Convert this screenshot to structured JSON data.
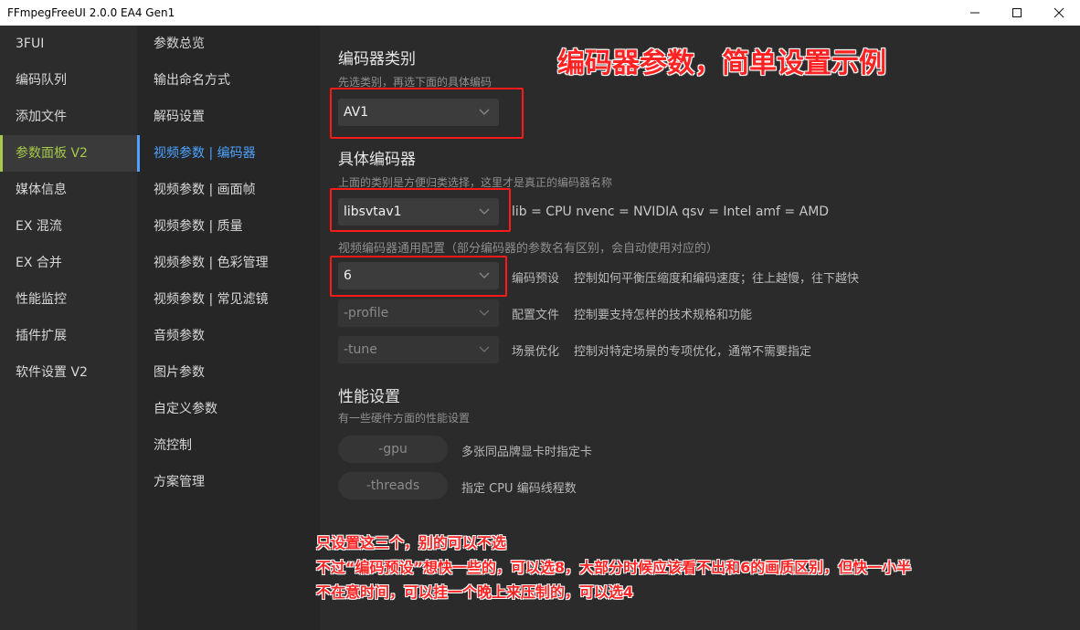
{
  "window": {
    "title": "FFmpegFreeUI 2.0.0 EA4 Gen1",
    "minimize": "—",
    "maximize": "☐",
    "close": "✕"
  },
  "sidebar_primary": {
    "items": [
      {
        "label": "3FUI"
      },
      {
        "label": "编码队列"
      },
      {
        "label": "添加文件"
      },
      {
        "label": "参数面板 V2",
        "active": true
      },
      {
        "label": "媒体信息"
      },
      {
        "label": "EX 混流"
      },
      {
        "label": "EX 合并"
      },
      {
        "label": "性能监控"
      },
      {
        "label": "插件扩展"
      },
      {
        "label": "软件设置 V2"
      }
    ]
  },
  "sidebar_secondary": {
    "items": [
      {
        "label": "参数总览"
      },
      {
        "label": "输出命名方式"
      },
      {
        "label": "解码设置"
      },
      {
        "label": "视频参数 | 编码器",
        "active": true
      },
      {
        "label": "视频参数 | 画面帧"
      },
      {
        "label": "视频参数 | 质量"
      },
      {
        "label": "视频参数 | 色彩管理"
      },
      {
        "label": "视频参数 | 常见滤镜"
      },
      {
        "label": "音频参数"
      },
      {
        "label": "图片参数"
      },
      {
        "label": "自定义参数"
      },
      {
        "label": "流控制"
      },
      {
        "label": "方案管理"
      }
    ]
  },
  "main": {
    "encoder_category": {
      "title": "编码器类别",
      "desc": "先选类别，再选下面的具体编码",
      "value": "AV1"
    },
    "specific_encoder": {
      "title": "具体编码器",
      "desc": "上面的类别是方便归类选择，这里才是真正的编码器名称",
      "value": "libsvtav1",
      "hint": "lib = CPU   nvenc = NVIDIA   qsv = Intel   amf = AMD"
    },
    "common_config_desc": "视频编码器通用配置（部分编码器的参数名有区别，会自动使用对应的）",
    "preset": {
      "value": "6",
      "label": "编码预设",
      "desc": "控制如何平衡压缩度和编码速度；往上越慢，往下越快"
    },
    "profile": {
      "value": "-profile",
      "label": "配置文件",
      "desc": "控制要支持怎样的技术规格和功能"
    },
    "tune": {
      "value": "-tune",
      "label": "场景优化",
      "desc": "控制对特定场景的专项优化，通常不需要指定"
    },
    "performance": {
      "title": "性能设置",
      "desc": "有一些硬件方面的性能设置",
      "gpu": {
        "value": "-gpu",
        "desc": "多张同品牌显卡时指定卡"
      },
      "threads": {
        "value": "-threads",
        "desc": "指定 CPU 编码线程数"
      }
    }
  },
  "annotations": {
    "headline": "编码器参数，简单设置示例",
    "note_lines": [
      "只设置这三个，别的可以不选",
      "不过“编码预设”想快一些的，可以选8，大部分时候应该看不出和6的画质区别，但快一小半",
      "不在意时间，可以挂一个晚上来压制的，可以选4"
    ],
    "color": "#ff2222"
  },
  "colors": {
    "accent_green": "#a6c94c",
    "accent_blue": "#4da3ff",
    "annotation_red": "#ff1a1a"
  }
}
